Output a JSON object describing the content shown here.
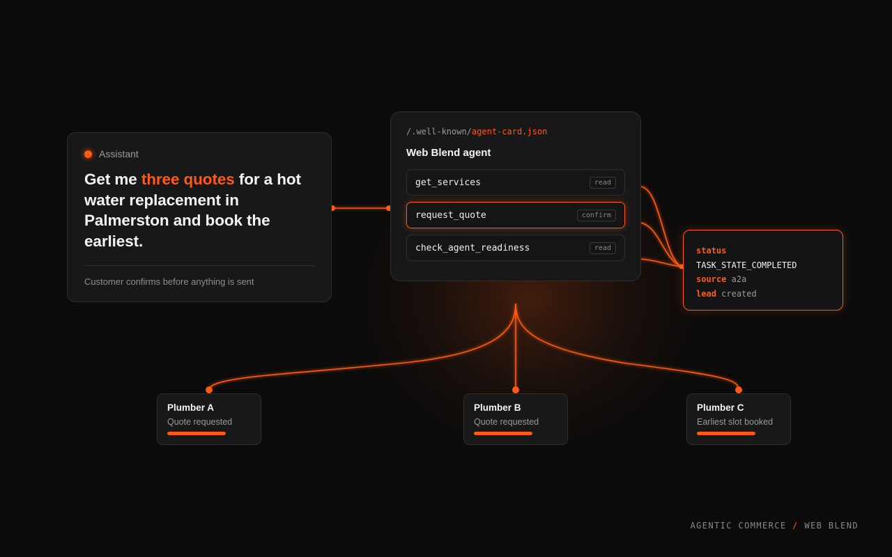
{
  "assistant": {
    "label": "Assistant",
    "prompt_before": "Get me ",
    "prompt_highlight": "three quotes",
    "prompt_after": " for a hot water replacement in Palmerston and book the earliest.",
    "footnote": "Customer confirms before anything is sent"
  },
  "agent_card": {
    "path_prefix": "/.well-known/",
    "path_file": "agent-card.json",
    "title": "Web Blend agent",
    "tools": [
      {
        "name": "get_services",
        "badge": "read",
        "active": false
      },
      {
        "name": "request_quote",
        "badge": "confirm",
        "active": true
      },
      {
        "name": "check_agent_readiness",
        "badge": "read",
        "active": false
      }
    ]
  },
  "status_card": {
    "status_key": "status",
    "status_value": "TASK_STATE_COMPLETED",
    "source_key": "source",
    "source_value": "a2a",
    "lead_key": "lead",
    "lead_value": "created"
  },
  "plumbers": [
    {
      "name": "Plumber A",
      "status": "Quote requested",
      "progress": 1.0
    },
    {
      "name": "Plumber B",
      "status": "Quote requested",
      "progress": 1.0
    },
    {
      "name": "Plumber C",
      "status": "Earliest slot booked",
      "progress": 1.0
    }
  ],
  "brand": {
    "left": "AGENTIC COMMERCE",
    "separator": "/",
    "right": "WEB BLEND"
  },
  "colors": {
    "accent": "#ff5a14",
    "background": "#0b0b0b",
    "card": "#181818"
  }
}
